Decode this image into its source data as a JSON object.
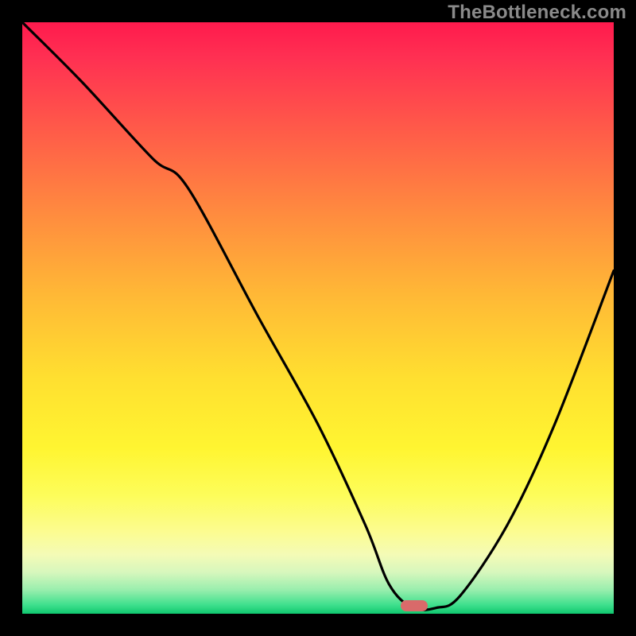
{
  "watermark": "TheBottleneck.com",
  "marker": {
    "x_frac": 0.662,
    "y_frac": 0.986,
    "color": "#d96a6a"
  },
  "chart_data": {
    "type": "line",
    "title": "",
    "xlabel": "",
    "ylabel": "",
    "xlim": [
      0,
      100
    ],
    "ylim": [
      0,
      100
    ],
    "series": [
      {
        "name": "bottleneck-curve",
        "x": [
          0,
          10,
          22,
          28,
          40,
          50,
          58,
          62,
          66,
          70,
          74,
          82,
          90,
          100
        ],
        "y": [
          100,
          90,
          77,
          72,
          50,
          32,
          15,
          5,
          1,
          1,
          3,
          15,
          32,
          58
        ]
      }
    ],
    "optimum": {
      "x": 66,
      "y": 1
    }
  }
}
